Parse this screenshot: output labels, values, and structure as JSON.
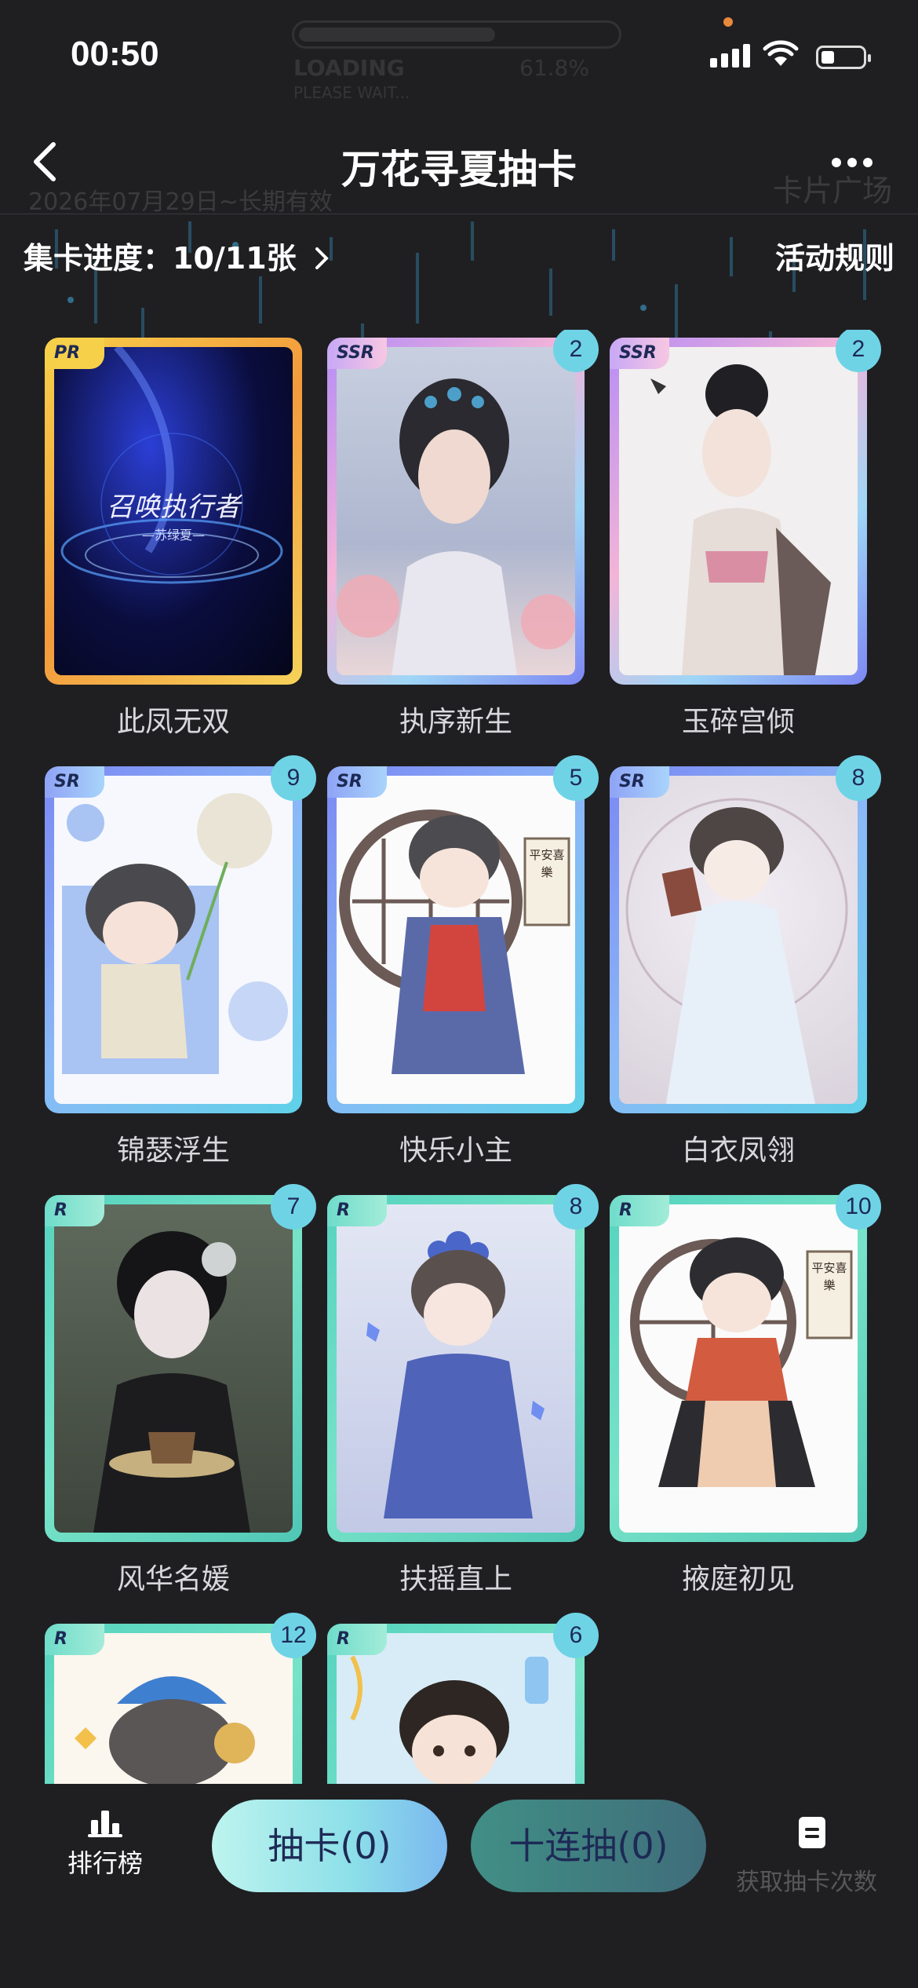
{
  "status": {
    "time": "00:50"
  },
  "loading_overlay": {
    "title": "LOADING",
    "percent": "61.8%",
    "subtitle": "PLEASE WAIT..."
  },
  "header": {
    "title": "万花寻夏抽卡",
    "ghost_date": "2026年07月29日~长期有效",
    "ghost_square": "卡片广场"
  },
  "collection": {
    "progress_label": "集卡进度：10/11张",
    "rules_label": "活动规则"
  },
  "cards": [
    {
      "name": "此凤无双",
      "rarity": "PR",
      "count": null,
      "art_title": "召唤执行者",
      "art_sub": "—苏绿夏—"
    },
    {
      "name": "执序新生",
      "rarity": "SSR",
      "count": "2"
    },
    {
      "name": "玉碎宫倾",
      "rarity": "SSR",
      "count": "2"
    },
    {
      "name": "锦瑟浮生",
      "rarity": "SR",
      "count": "9"
    },
    {
      "name": "快乐小主",
      "rarity": "SR",
      "count": "5",
      "scroll_text": "平安喜樂"
    },
    {
      "name": "白衣凤翎",
      "rarity": "SR",
      "count": "8"
    },
    {
      "name": "风华名媛",
      "rarity": "R",
      "count": "7"
    },
    {
      "name": "扶摇直上",
      "rarity": "R",
      "count": "8"
    },
    {
      "name": "掖庭初见",
      "rarity": "R",
      "count": "10",
      "scroll_text": "平安喜樂"
    },
    {
      "name": "",
      "rarity": "R",
      "count": "12"
    },
    {
      "name": "",
      "rarity": "R",
      "count": "6"
    }
  ],
  "bottom_bar": {
    "rank_label": "排行榜",
    "draw_label": "抽卡(0)",
    "ten_draw_label": "十连抽(0)",
    "ghost_label": "获取抽卡次数"
  },
  "colors": {
    "background": "#1f1f22",
    "accent_teal": "#6fd3e6",
    "pr_gold": "#f7d04a"
  },
  "icons": {
    "back": "chevron-left-icon",
    "more": "more-dots-icon",
    "rank": "bar-chart-icon",
    "doc": "document-icon"
  }
}
